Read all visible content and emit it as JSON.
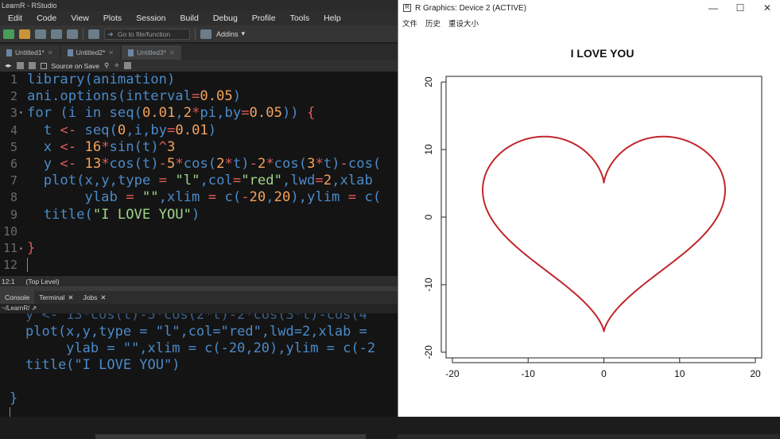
{
  "rstudio": {
    "title": "LearnR - RStudio",
    "menu": [
      "Edit",
      "Code",
      "View",
      "Plots",
      "Session",
      "Build",
      "Debug",
      "Profile",
      "Tools",
      "Help"
    ],
    "toolbar": {
      "goto_placeholder": "Go to file/function",
      "addins": "Addins"
    },
    "tabs": [
      {
        "label": "Untitled1*"
      },
      {
        "label": "Untitled2*"
      },
      {
        "label": "Untitled3*"
      }
    ],
    "editor_toolbar": {
      "source_on_save": "Source on Save"
    },
    "status": {
      "position": "12:1",
      "scope": "(Top Level)"
    },
    "console_tabs": [
      "Console",
      "Terminal",
      "Jobs"
    ],
    "console_path": "~/LearnR/"
  },
  "code_lines": [
    {
      "n": "1",
      "text": "library(animation)"
    },
    {
      "n": "2",
      "text": "ani.options(interval=0.05)"
    },
    {
      "n": "3",
      "text": "for (i in seq(0.01,2*pi,by=0.05)) {"
    },
    {
      "n": "4",
      "text": "  t <- seq(0,i,by=0.01)"
    },
    {
      "n": "5",
      "text": "  x <- 16*sin(t)^3"
    },
    {
      "n": "6",
      "text": "  y <- 13*cos(t)-5*cos(2*t)-2*cos(3*t)-cos("
    },
    {
      "n": "7",
      "text": "  plot(x,y,type = \"l\",col=\"red\",lwd=2,xlab"
    },
    {
      "n": "8",
      "text": "       ylab = \"\",xlim = c(-20,20),ylim = c("
    },
    {
      "n": "9",
      "text": "  title(\"I LOVE YOU\")"
    },
    {
      "n": "10",
      "text": ""
    },
    {
      "n": "11",
      "text": "}"
    },
    {
      "n": "12",
      "text": ""
    }
  ],
  "console_lines": [
    "y <- 13*cos(t)-5*cos(2*t)-2*cos(3*t)-cos(4",
    "plot(x,y,type = \"l\",col=\"red\",lwd=2,xlab =",
    "     ylab = \"\",xlim = c(-20,20),ylim = c(-2",
    "title(\"I LOVE YOU\")",
    "",
    "}"
  ],
  "graphics_window": {
    "title": "R Graphics: Device 2 (ACTIVE)",
    "menu": [
      "文件",
      "历史",
      "重设大小"
    ],
    "window_buttons": [
      "—",
      "☐",
      "✕"
    ]
  },
  "chart_data": {
    "type": "line",
    "title": "I LOVE YOU",
    "xlabel": "",
    "ylabel": "",
    "xlim": [
      -20,
      20
    ],
    "ylim": [
      -20,
      20
    ],
    "xticks": [
      "-20",
      "-10",
      "0",
      "10",
      "20"
    ],
    "yticks": [
      "-20",
      "-10",
      "0",
      "10",
      "20"
    ],
    "series": [
      {
        "color": "#c0262b",
        "x_formula": "16*sin(t)^3",
        "y_formula": "13*cos(t)-5*cos(2*t)-2*cos(3*t)-cos(4*t)",
        "t_range": [
          0,
          6.28
        ]
      }
    ],
    "grid": false
  }
}
